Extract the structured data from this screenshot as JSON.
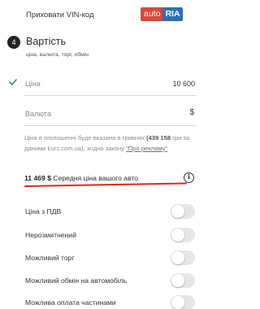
{
  "vin": {
    "label": "Приховати VIN-код"
  },
  "logo": {
    "part1": "auto",
    "part2": "RIA",
    "mark": "••"
  },
  "section": {
    "step": "4",
    "title": "Вартість",
    "subtitle": "ціна, валюта, торг, обмін"
  },
  "price": {
    "label": "Ціна",
    "value": "10 600"
  },
  "currency": {
    "label": "Валюта",
    "symbol": "$"
  },
  "info": {
    "line1": "Ціна в оголошенні буде вказана в гривнях",
    "amount": "(439 158",
    "line2": " грн за даними kurs.com.ua), згідно закону ",
    "link": "\"Про рекламу\""
  },
  "average": {
    "amount": "11 469 $",
    "label": "Середня ціна вашого авто",
    "info_icon": "i"
  },
  "options": [
    {
      "label": "Ціна з ПДВ",
      "on": false
    },
    {
      "label": "Нерозмитнений",
      "on": false
    },
    {
      "label": "Можливий торг",
      "on": false
    },
    {
      "label": "Можливий обмін на автомобіль",
      "on": false
    },
    {
      "label": "Можлива оплата частинами",
      "on": false
    }
  ],
  "colors": {
    "accent_red": "#e1261c",
    "logo_red": "#d8483d",
    "logo_blue": "#2f6fb5",
    "check_green": "#1c9b5b"
  }
}
